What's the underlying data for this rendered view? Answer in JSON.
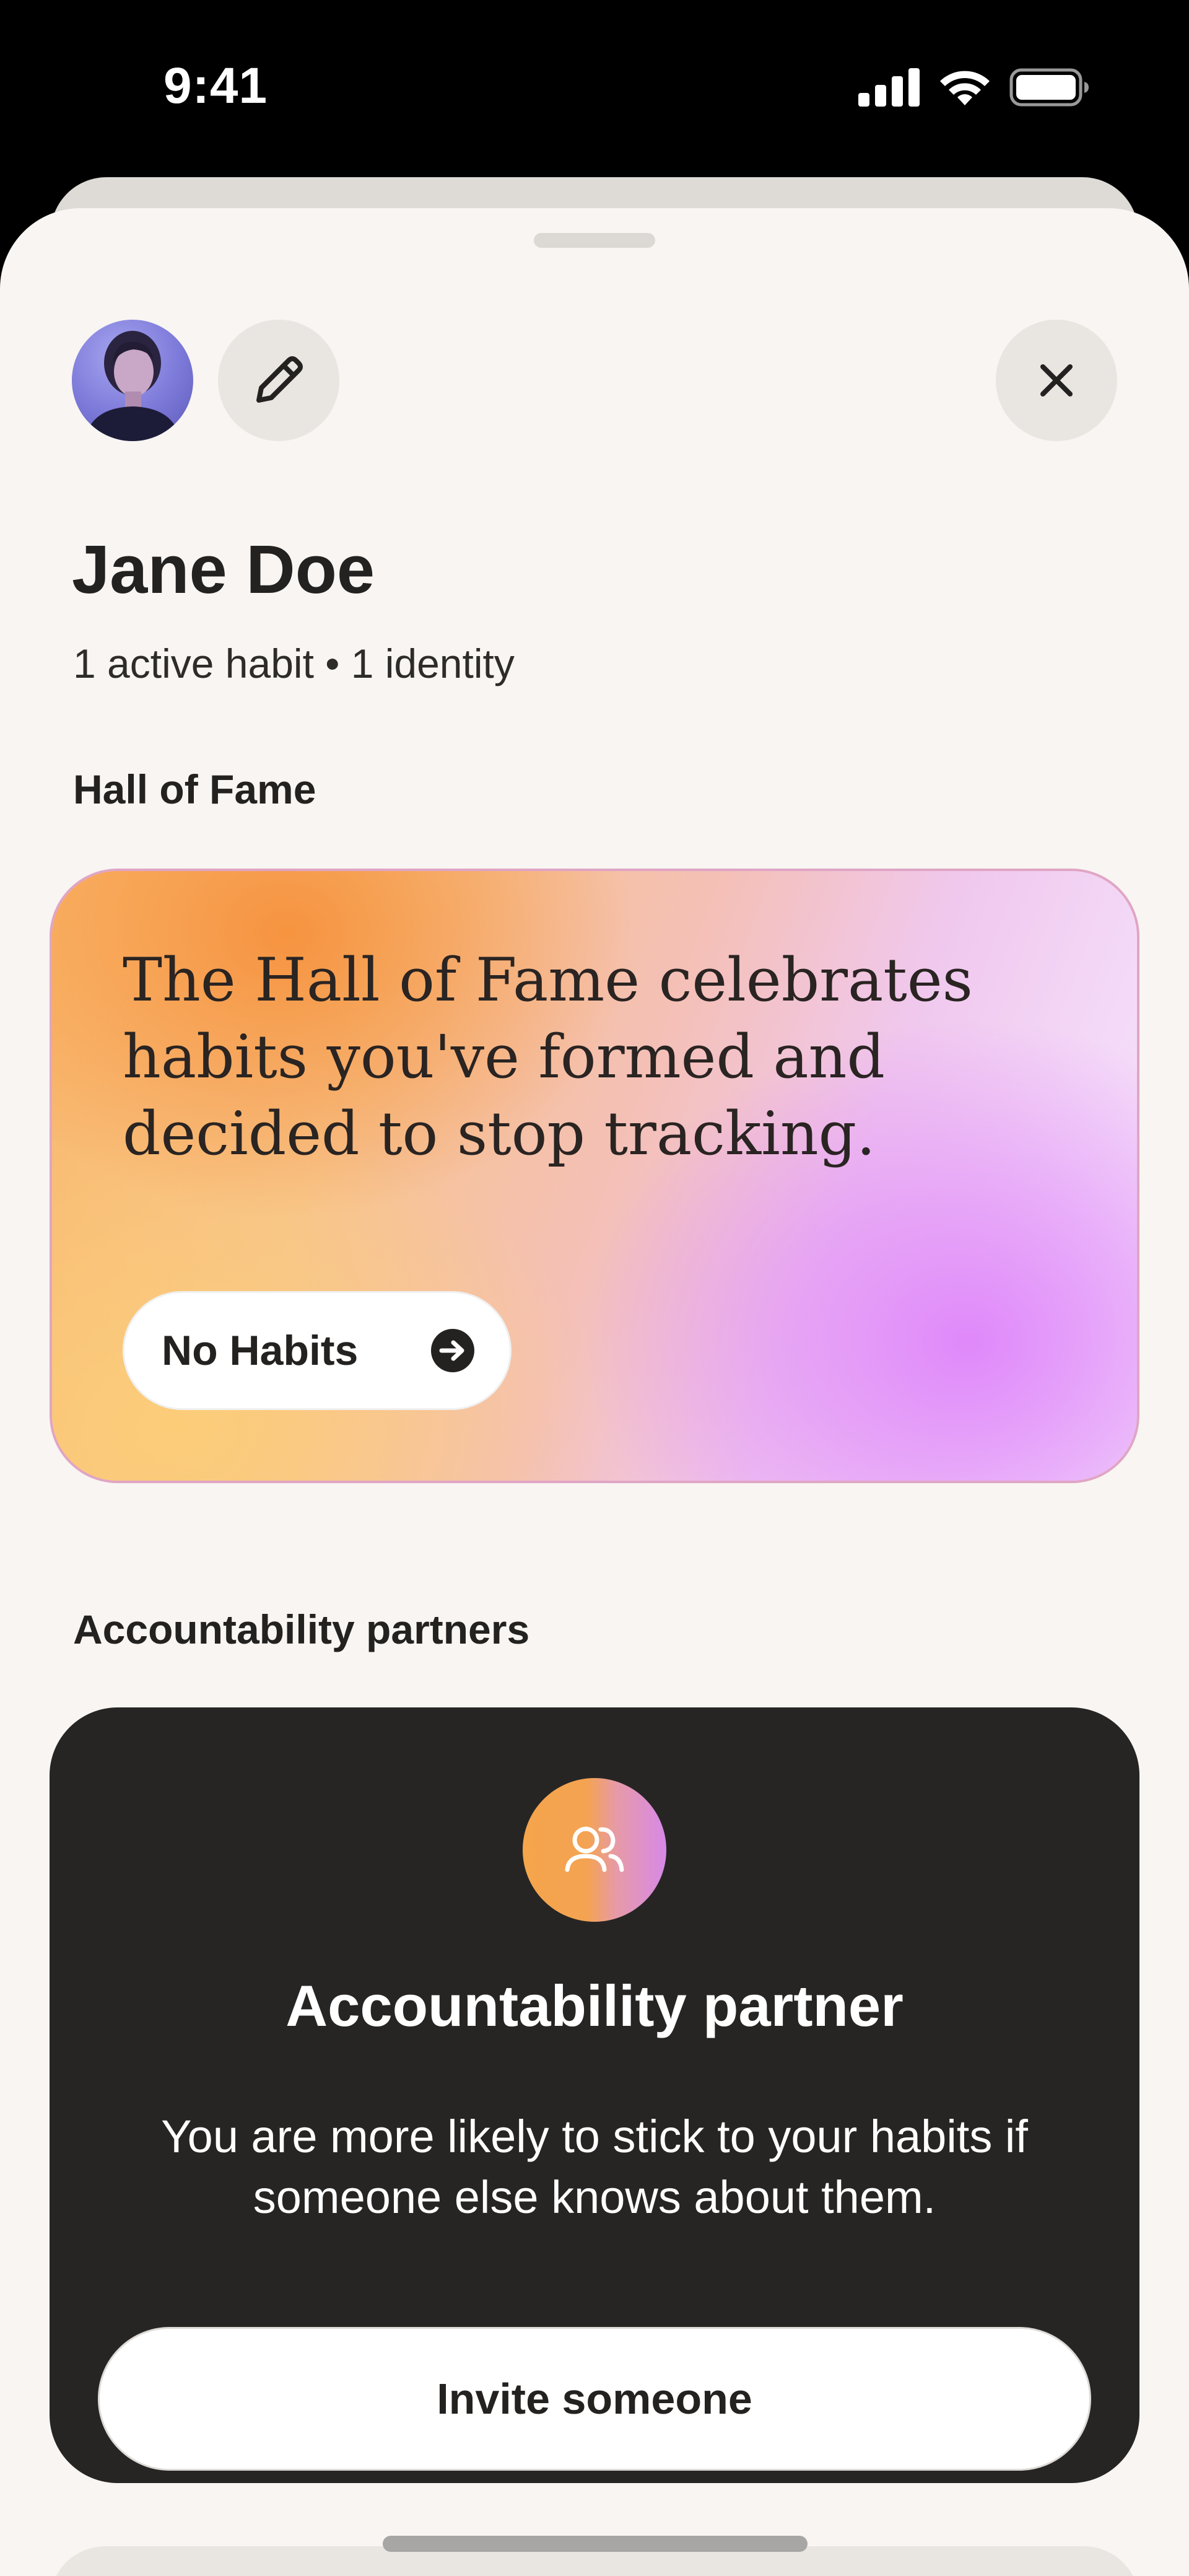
{
  "status_bar": {
    "time": "9:41"
  },
  "profile": {
    "name": "Jane Doe",
    "meta": "1 active habit • 1 identity"
  },
  "hall_of_fame": {
    "title": "Hall of Fame",
    "description": "The Hall of Fame celebrates habits you've formed and decided to stop tracking.",
    "button_label": "No Habits"
  },
  "accountability": {
    "section_title": "Accountability partners",
    "card_title": "Accountability partner",
    "card_body": "You are more likely to stick to your habits if someone else knows about them.",
    "button_label": "Invite someone"
  },
  "icons": {
    "edit": "pencil-icon",
    "close": "close-icon",
    "arrow": "arrow-right-circle-icon",
    "partners": "people-icon",
    "signal": "cellular-signal-icon",
    "wifi": "wifi-icon",
    "battery": "battery-icon"
  },
  "colors": {
    "sheet_background": "#f8f5f2",
    "card_dark": "#262524",
    "text_primary": "#242220",
    "accent_orange": "#f6913c",
    "accent_purple": "#de84fa"
  }
}
